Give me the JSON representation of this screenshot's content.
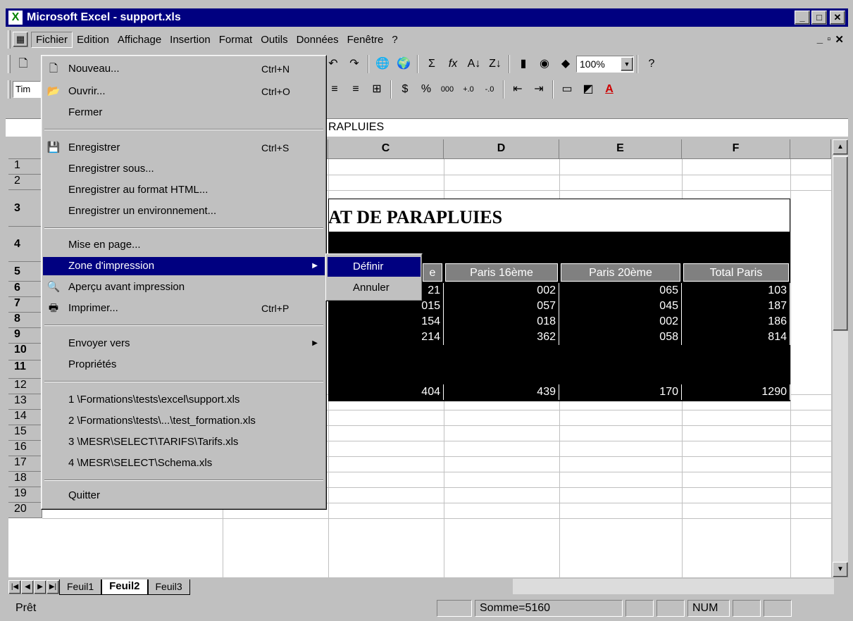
{
  "window": {
    "title": "Microsoft Excel - support.xls",
    "app_icon": "excel-icon"
  },
  "menubar": {
    "items": [
      "Fichier",
      "Edition",
      "Affichage",
      "Insertion",
      "Format",
      "Outils",
      "Données",
      "Fenêtre",
      "?"
    ]
  },
  "toolbar": {
    "zoom": "100%",
    "font": "Tim"
  },
  "formula_bar": {
    "text": "RAPLUIES"
  },
  "columns": [
    "C",
    "D",
    "E",
    "F"
  ],
  "rows": [
    "1",
    "2",
    "3",
    "4",
    "5",
    "6",
    "7",
    "8",
    "9",
    "10",
    "11",
    "12",
    "13",
    "14",
    "15",
    "16",
    "17",
    "18",
    "19",
    "20"
  ],
  "sheet": {
    "title": "AT DE PARAPLUIES",
    "headers": [
      "e",
      "Paris 16ème",
      "Paris 20ème",
      "Total Paris"
    ],
    "data": [
      [
        "21",
        "002",
        "065",
        "103"
      ],
      [
        "015",
        "057",
        "045",
        "187"
      ],
      [
        "154",
        "018",
        "002",
        "186"
      ],
      [
        "214",
        "362",
        "058",
        "814"
      ],
      [
        "",
        "",
        "",
        ""
      ],
      [
        "404",
        "439",
        "170",
        "1290"
      ]
    ]
  },
  "file_menu": {
    "items": [
      {
        "label": "Nouveau...",
        "shortcut": "Ctrl+N",
        "icon": "new-document-icon"
      },
      {
        "label": "Ouvrir...",
        "shortcut": "Ctrl+O",
        "icon": "open-folder-icon"
      },
      {
        "label": "Fermer",
        "shortcut": ""
      },
      {
        "label": "Enregistrer",
        "shortcut": "Ctrl+S",
        "icon": "save-icon"
      },
      {
        "label": "Enregistrer sous...",
        "shortcut": ""
      },
      {
        "label": "Enregistrer au format HTML...",
        "shortcut": ""
      },
      {
        "label": "Enregistrer un environnement...",
        "shortcut": ""
      },
      {
        "label": "Mise en page...",
        "shortcut": ""
      },
      {
        "label": "Zone d'impression",
        "shortcut": ""
      },
      {
        "label": "Aperçu avant impression",
        "shortcut": "",
        "icon": "print-preview-icon"
      },
      {
        "label": "Imprimer...",
        "shortcut": "Ctrl+P",
        "icon": "printer-icon"
      },
      {
        "label": "Envoyer vers",
        "shortcut": ""
      },
      {
        "label": "Propriétés",
        "shortcut": ""
      },
      {
        "label": "1 \\Formations\\tests\\excel\\support.xls",
        "shortcut": ""
      },
      {
        "label": "2 \\Formations\\tests\\...\\test_formation.xls",
        "shortcut": ""
      },
      {
        "label": "3 \\MESR\\SELECT\\TARIFS\\Tarifs.xls",
        "shortcut": ""
      },
      {
        "label": "4 \\MESR\\SELECT\\Schema.xls",
        "shortcut": ""
      },
      {
        "label": "Quitter",
        "shortcut": ""
      }
    ]
  },
  "submenu": {
    "items": [
      "Définir",
      "Annuler"
    ]
  },
  "sheet_tabs": [
    "Feuil1",
    "Feuil2",
    "Feuil3"
  ],
  "status": {
    "ready": "Prêt",
    "sum": "Somme=5160",
    "num": "NUM"
  }
}
